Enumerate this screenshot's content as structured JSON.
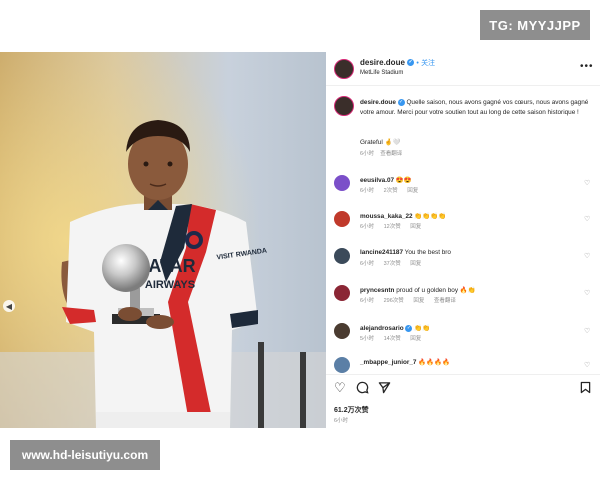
{
  "watermarks": {
    "top": "TG: MYYJJPP",
    "bottom": "www.hd-leisutiyu.com"
  },
  "post": {
    "username": "desire.doue",
    "follow_label": "关注",
    "location": "MetLife Stadium",
    "more_label": "•••",
    "caption_user": "desire.doue",
    "caption_text": "Quelle saison, nous avons gagné vos cœurs, nous avons gagné votre amour. Merci pour votre soutien tout au long de cette saison historique !",
    "caption_extra": "Grateful 🤞🤍",
    "caption_time": "6小时",
    "caption_translate": "查看翻译",
    "likes": "61.2万次赞",
    "time": "6小时"
  },
  "photo": {
    "jersey_sponsor_line1": "QATAR",
    "jersey_sponsor_line2": "AIRWAYS",
    "sleeve_text": "VISIT RWANDA"
  },
  "comments": [
    {
      "user": "eeusilva.07",
      "text": "😍😍",
      "time": "6小时",
      "likes": "2次赞",
      "reply": "回复",
      "translate": "",
      "avatar_color": "#7b4fc9"
    },
    {
      "user": "moussa_kaka_22",
      "text": "👏👏👏👏",
      "time": "6小时",
      "likes": "12次赞",
      "reply": "回复",
      "translate": "",
      "avatar_color": "#c0392b"
    },
    {
      "user": "lancine241187",
      "text": "You the best bro",
      "time": "6小时",
      "likes": "37次赞",
      "reply": "回复",
      "translate": "",
      "avatar_color": "#3b4a5a"
    },
    {
      "user": "pryncesntn",
      "text": "proud of u golden boy 🔥👏",
      "time": "6小时",
      "likes": "296次赞",
      "reply": "回复",
      "translate": "查看翻译",
      "avatar_color": "#8b2635"
    },
    {
      "user": "alejandrosario",
      "text": "👏👏",
      "time": "5小时",
      "likes": "14次赞",
      "reply": "回复",
      "translate": "",
      "avatar_color": "#4a3b30"
    },
    {
      "user": "_mbappe_junior_7",
      "text": "🔥🔥🔥🔥",
      "time": "",
      "likes": "",
      "reply": "",
      "translate": "",
      "avatar_color": "#5b7fa6"
    }
  ],
  "icons": {
    "like": "heart-icon",
    "comment": "comment-icon",
    "share": "share-icon",
    "save": "bookmark-icon"
  }
}
